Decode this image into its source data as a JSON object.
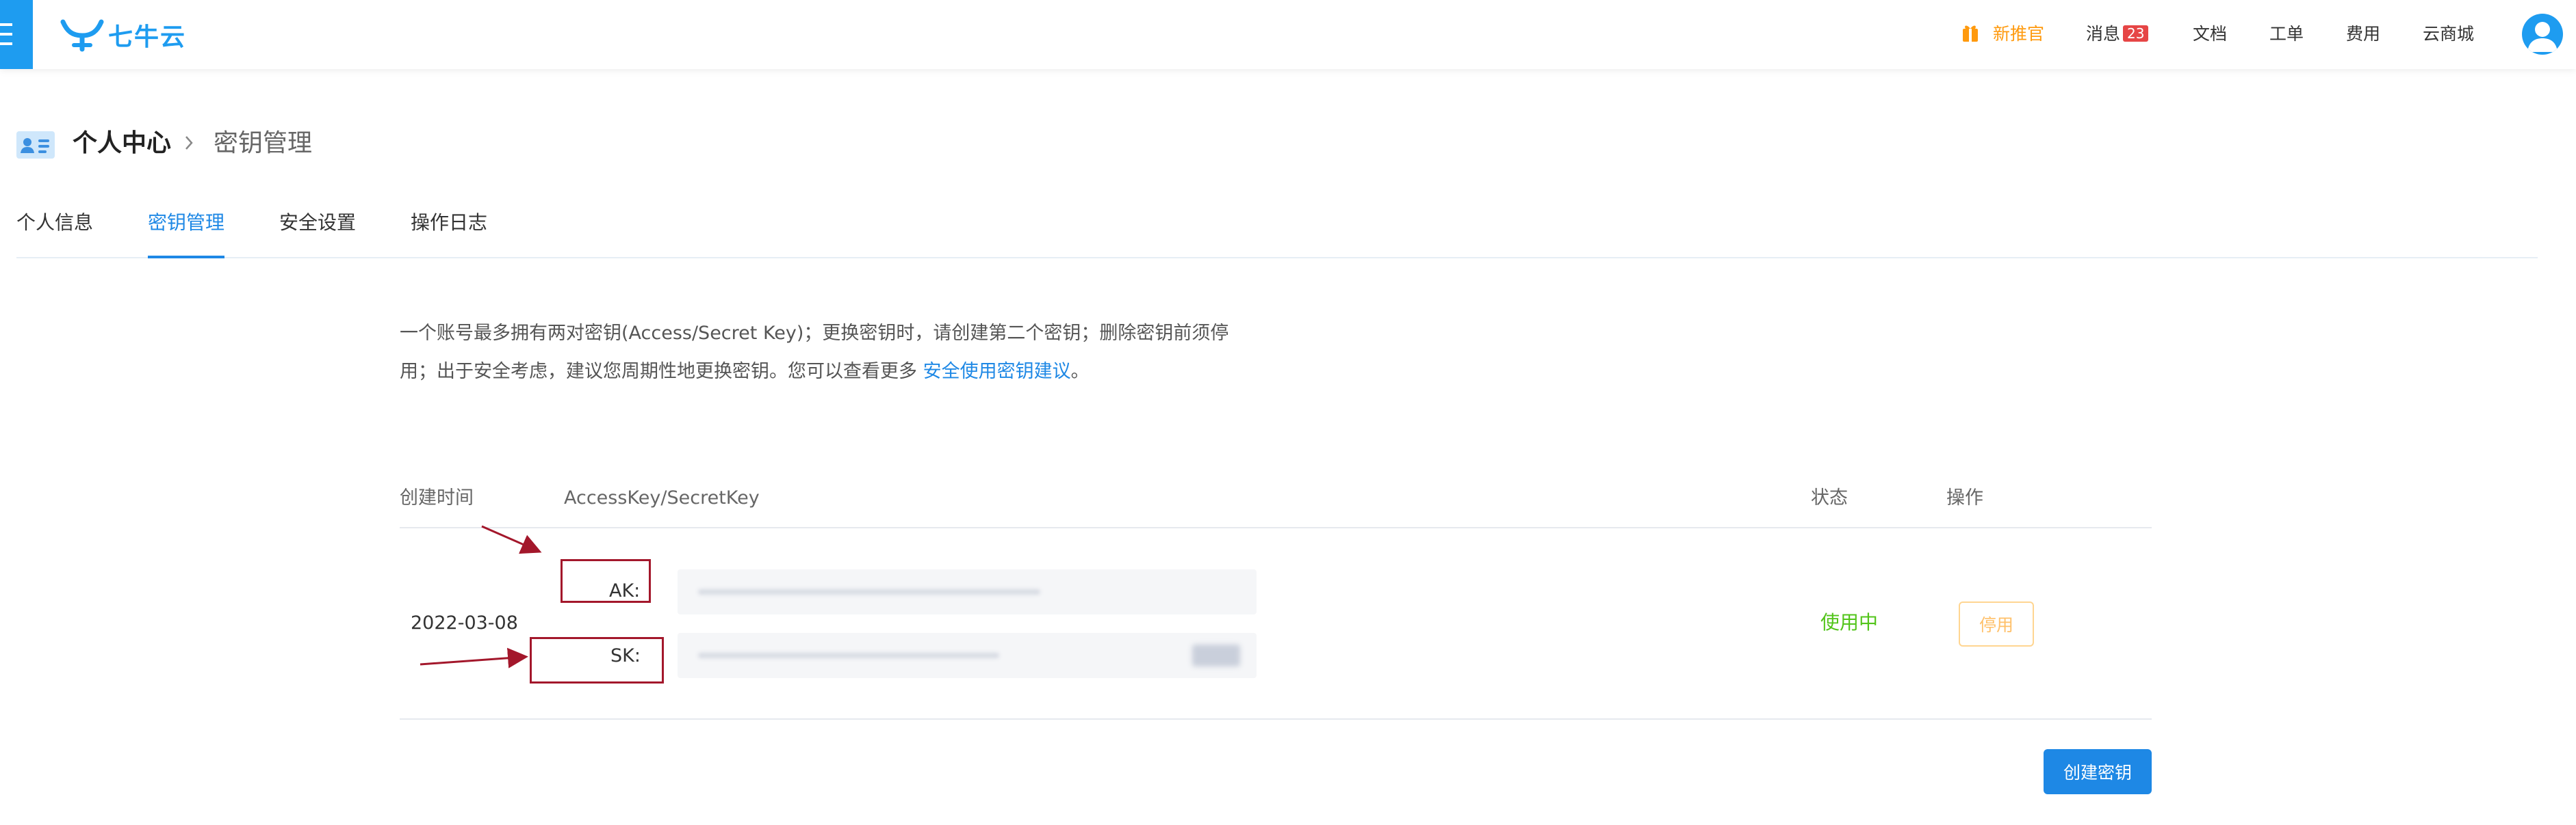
{
  "topbar": {
    "logo_text": "七牛云",
    "nav": {
      "promo": "新推官",
      "messages": "消息",
      "messages_count": "23",
      "docs": "文档",
      "tickets": "工单",
      "billing": "费用",
      "marketplace": "云商城"
    },
    "promo_color": "#ff9a0e",
    "brand_color": "#1e9cf0"
  },
  "breadcrumb": {
    "parent": "个人中心",
    "current": "密钥管理"
  },
  "tabs": [
    {
      "label": "个人信息",
      "active": false
    },
    {
      "label": "密钥管理",
      "active": true
    },
    {
      "label": "安全设置",
      "active": false
    },
    {
      "label": "操作日志",
      "active": false
    }
  ],
  "description": {
    "line1": "一个账号最多拥有两对密钥(Access/Secret Key)；更换密钥时，请创建第二个密钥；删除密钥前须停",
    "line2": "用；出于安全考虑，建议您周期性地更换密钥。您可以查看更多 ",
    "link": "安全使用密钥建议",
    "line2_end": "。"
  },
  "table": {
    "headers": {
      "created": "创建时间",
      "key": "AccessKey/SecretKey",
      "status": "状态",
      "actions": "操作"
    },
    "rows": [
      {
        "created": "2022-03-08",
        "ak_label": "AK:",
        "sk_label": "SK:",
        "status": "使用中",
        "action": "停用"
      }
    ]
  },
  "create_button": "创建密钥",
  "icons": {
    "menu": "menu-icon",
    "gift": "gift-icon",
    "avatar": "user-avatar-icon",
    "page": "id-card-icon",
    "separator": "chevron-right-icon"
  },
  "colors": {
    "accent": "#1e88e5",
    "status_active": "#52c41a",
    "disable_button": "#ffc069",
    "annotation": "#a3172b"
  }
}
